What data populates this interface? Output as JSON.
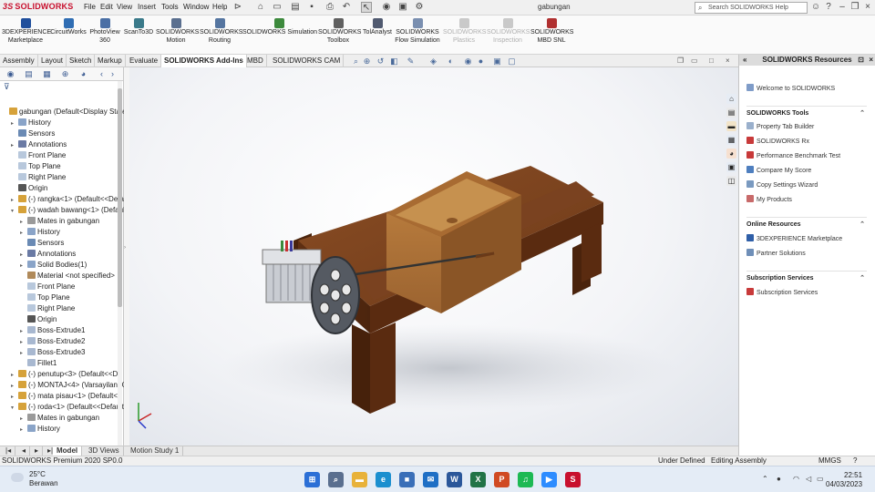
{
  "app": {
    "logo_text": "SOLIDWORKS",
    "doc_title": "gabungan"
  },
  "menu": [
    "File",
    "Edit",
    "View",
    "Insert",
    "Tools",
    "Window",
    "Help"
  ],
  "help_search": {
    "placeholder": "Search SOLIDWORKS Help"
  },
  "ribbon": [
    {
      "label": "3DEXPERIENCE\nMarketplace",
      "color": "#1f4e9c"
    },
    {
      "label": "CircuitWorks",
      "color": "#2f6db3"
    },
    {
      "label": "PhotoView\n360",
      "color": "#4a6fa5"
    },
    {
      "label": "ScanTo3D",
      "color": "#3a7a8a"
    },
    {
      "label": "SOLIDWORKS\nMotion",
      "color": "#5a6f8f"
    },
    {
      "label": "SOLIDWORKS\nRouting",
      "color": "#5575a0"
    },
    {
      "label": "SOLIDWORKS Simulation",
      "color": "#3d8a3d"
    },
    {
      "label": "SOLIDWORKS\nToolbox",
      "color": "#606060"
    },
    {
      "label": "TolAnalyst",
      "color": "#505a70"
    },
    {
      "label": "SOLIDWORKS\nFlow Simulation",
      "color": "#7a8fb0"
    },
    {
      "label": "SOLIDWORKS\nPlastics",
      "color": "#c9c9c9"
    },
    {
      "label": "SOLIDWORKS\nInspection",
      "color": "#c9c9c9"
    },
    {
      "label": "SOLIDWORKS\nMBD SNL",
      "color": "#b03030"
    }
  ],
  "tabs": [
    "Assembly",
    "Layout",
    "Sketch",
    "Markup",
    "Evaluate",
    "SOLIDWORKS Add-Ins",
    "MBD",
    "SOLIDWORKS CAM"
  ],
  "active_tab": "SOLIDWORKS Add-Ins",
  "tree": [
    {
      "label": "gabungan  (Default<Display State",
      "level": 0,
      "icon": "assembly",
      "twisty": ""
    },
    {
      "label": "History",
      "level": 1,
      "icon": "history",
      "twisty": "▸"
    },
    {
      "label": "Sensors",
      "level": 1,
      "icon": "sensor",
      "twisty": ""
    },
    {
      "label": "Annotations",
      "level": 1,
      "icon": "annotation",
      "twisty": "▸"
    },
    {
      "label": "Front Plane",
      "level": 1,
      "icon": "plane",
      "twisty": ""
    },
    {
      "label": "Top Plane",
      "level": 1,
      "icon": "plane",
      "twisty": ""
    },
    {
      "label": "Right Plane",
      "level": 1,
      "icon": "plane",
      "twisty": ""
    },
    {
      "label": "Origin",
      "level": 1,
      "icon": "origin",
      "twisty": ""
    },
    {
      "label": "(-) rangka<1> (Default<<Defa",
      "level": 1,
      "icon": "part",
      "twisty": "▸"
    },
    {
      "label": "(-) wadah bawang<1> (Defaul",
      "level": 1,
      "icon": "part",
      "twisty": "▾"
    },
    {
      "label": "Mates in gabungan",
      "level": 2,
      "icon": "mate",
      "twisty": "▸"
    },
    {
      "label": "History",
      "level": 2,
      "icon": "history",
      "twisty": "▸"
    },
    {
      "label": "Sensors",
      "level": 2,
      "icon": "sensor",
      "twisty": ""
    },
    {
      "label": "Annotations",
      "level": 2,
      "icon": "annotation",
      "twisty": "▸"
    },
    {
      "label": "Solid Bodies(1)",
      "level": 2,
      "icon": "body",
      "twisty": "▸"
    },
    {
      "label": "Material <not specified>",
      "level": 2,
      "icon": "material",
      "twisty": ""
    },
    {
      "label": "Front Plane",
      "level": 2,
      "icon": "plane",
      "twisty": ""
    },
    {
      "label": "Top Plane",
      "level": 2,
      "icon": "plane",
      "twisty": ""
    },
    {
      "label": "Right Plane",
      "level": 2,
      "icon": "plane",
      "twisty": ""
    },
    {
      "label": "Origin",
      "level": 2,
      "icon": "origin",
      "twisty": ""
    },
    {
      "label": "Boss-Extrude1",
      "level": 2,
      "icon": "feature",
      "twisty": "▸"
    },
    {
      "label": "Boss-Extrude2",
      "level": 2,
      "icon": "feature",
      "twisty": "▸"
    },
    {
      "label": "Boss-Extrude3",
      "level": 2,
      "icon": "feature",
      "twisty": "▸"
    },
    {
      "label": "Fillet1",
      "level": 2,
      "icon": "fillet",
      "twisty": ""
    },
    {
      "label": "(-) penutup<3> (Default<<De",
      "level": 1,
      "icon": "part",
      "twisty": "▸"
    },
    {
      "label": "(-) MONTAJ<4> (Varsayilan<G",
      "level": 1,
      "icon": "part",
      "twisty": "▸"
    },
    {
      "label": "(-) mata pisau<1> (Default<<",
      "level": 1,
      "icon": "part",
      "twisty": "▸"
    },
    {
      "label": "(-) roda<1> (Default<<Default",
      "level": 1,
      "icon": "part",
      "twisty": "▾"
    },
    {
      "label": "Mates in gabungan",
      "level": 2,
      "icon": "mate",
      "twisty": "▸"
    },
    {
      "label": "History",
      "level": 2,
      "icon": "history",
      "twisty": "▸"
    }
  ],
  "bottom_tabs": [
    "Model",
    "3D Views",
    "Motion Study 1"
  ],
  "active_bottom_tab": "Model",
  "status": {
    "left": "SOLIDWORKS Premium 2020 SP0.0",
    "state": "Under Defined",
    "mode": "Editing Assembly",
    "units": "MMGS"
  },
  "task_pane": {
    "title": "SOLIDWORKS Resources",
    "welcome": "Welcome to SOLIDWORKS",
    "sections": [
      {
        "title": "SOLIDWORKS Tools",
        "links": [
          "Property Tab Builder",
          "SOLIDWORKS Rx",
          "Performance Benchmark Test",
          "Compare My Score",
          "Copy Settings Wizard",
          "My Products"
        ]
      },
      {
        "title": "Online Resources",
        "links": [
          "3DEXPERIENCE Marketplace",
          "Partner Solutions"
        ]
      },
      {
        "title": "Subscription Services",
        "links": [
          "Subscription Services"
        ]
      }
    ]
  },
  "taskbar": {
    "weather_temp": "25°C",
    "weather_desc": "Berawan",
    "time": "22:51",
    "date": "04/03/2023",
    "apps": [
      {
        "name": "start",
        "color": "#2b6fd6",
        "glyph": "⊞"
      },
      {
        "name": "search",
        "color": "#5a6f8f",
        "glyph": "⌕"
      },
      {
        "name": "file-explorer",
        "color": "#e8b23a",
        "glyph": "▬"
      },
      {
        "name": "edge",
        "color": "#1b8fcf",
        "glyph": "e"
      },
      {
        "name": "store",
        "color": "#3a6fb8",
        "glyph": "■"
      },
      {
        "name": "mail",
        "color": "#1f6fc5",
        "glyph": "✉"
      },
      {
        "name": "word",
        "color": "#2b579a",
        "glyph": "W"
      },
      {
        "name": "excel",
        "color": "#217346",
        "glyph": "X"
      },
      {
        "name": "powerpoint",
        "color": "#d04a23",
        "glyph": "P"
      },
      {
        "name": "spotify",
        "color": "#1db954",
        "glyph": "♫"
      },
      {
        "name": "zoom",
        "color": "#2d8cff",
        "glyph": "▶"
      },
      {
        "name": "solidworks",
        "color": "#c8102e",
        "glyph": "S"
      }
    ]
  }
}
